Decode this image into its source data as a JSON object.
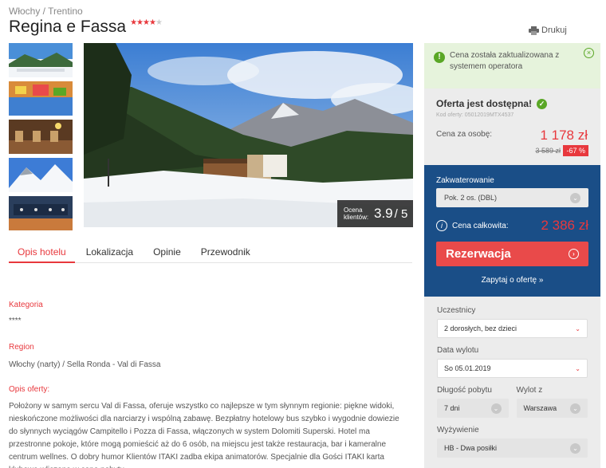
{
  "breadcrumb": "Włochy / Trentino",
  "hotel": {
    "name": "Regina e Fassa",
    "stars_filled": "★★★★",
    "stars_empty": "★",
    "star_rating": 4
  },
  "print_label": "Drukuj",
  "rating": {
    "label": "Ocena klientów:",
    "value": "3.9",
    "max": "/ 5"
  },
  "tabs": [
    "Opis hotelu",
    "Lokalizacja",
    "Opinie",
    "Przewodnik"
  ],
  "sections": {
    "category_label": "Kategoria",
    "category_value": "****",
    "region_label": "Region",
    "region_value": "Włochy (narty) / Sella Ronda - Val di Fassa",
    "offer_label": "Opis oferty:",
    "offer_text": "Położony w samym sercu Val di Fassa, oferuje wszystko co najlepsze w tym słynnym regionie: piękne widoki, nieskończone możliwości dla narciarzy i wspólną zabawę. Bezpłatny hotelowy bus szybko i wygodnie dowiezie do słynnych wyciągów Campitello i Pozza di Fassa, włączonych w system Dolomiti Superski. Hotel ma przestronne pokoje, które mogą pomieścić aż do 6 osób, na miejscu jest także restauracja, bar i kameralne centrum wellnes. O dobry humor Klientów ITAKI zadba ekipa animatorów. Specjalnie dla Gości ITAKI karta klubowa wliczona w cenę pobytu."
  },
  "notice": {
    "text": "Cena została zaktualizowana z systemem operatora",
    "icon": "!",
    "close": "×"
  },
  "offer": {
    "title": "Oferta jest dostępna!",
    "code": "Kod oferty: 05012019MTX4537",
    "price_label": "Cena za osobę:",
    "price": "1 178 zł",
    "old_price": "3 589 zł",
    "discount": "-67 %"
  },
  "booking": {
    "accommodation_label": "Zakwaterowanie",
    "accommodation_value": "Pok. 2 os. (DBL)",
    "total_label": "Cena całkowita:",
    "total_price": "2 386 zł",
    "reserve_label": "Rezerwacja",
    "ask_label": "Zapytaj o ofertę »"
  },
  "params": {
    "participants_label": "Uczestnicy",
    "participants_value": "2 dorosłych, bez dzieci",
    "departure_label": "Data wylotu",
    "departure_value": "So 05.01.2019",
    "length_label": "Długość pobytu",
    "length_value": "7 dni",
    "from_label": "Wylot z",
    "from_value": "Warszawa",
    "board_label": "Wyżywienie",
    "board_value": "HB - Dwa posiłki"
  },
  "colors": {
    "accent_red": "#e8383d",
    "booking_blue": "#1a4e87",
    "notice_green": "#e6f3dc",
    "ok_green": "#5aa726"
  }
}
